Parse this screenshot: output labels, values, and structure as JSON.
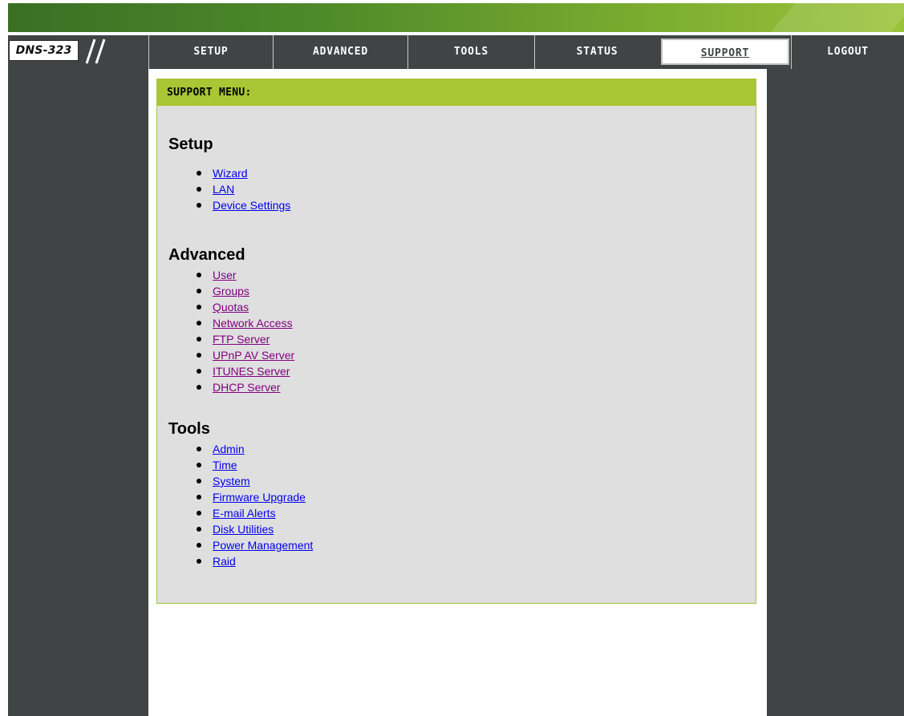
{
  "brand": {
    "logo_text": "DNS-323"
  },
  "nav": {
    "items": [
      {
        "label": "SETUP"
      },
      {
        "label": "ADVANCED"
      },
      {
        "label": "TOOLS"
      },
      {
        "label": "STATUS"
      },
      {
        "label": "SUPPORT",
        "active": true
      },
      {
        "label": "LOGOUT"
      }
    ]
  },
  "support": {
    "header": "SUPPORT MENU:",
    "sections": [
      {
        "title": "Setup",
        "links": [
          "Wizard",
          "LAN",
          "Device Settings"
        ]
      },
      {
        "title": "Advanced",
        "links": [
          "User",
          "Groups",
          "Quotas",
          "Network Access",
          "FTP Server",
          "UPnP AV Server",
          "ITUNES Server",
          "DHCP Server"
        ]
      },
      {
        "title": "Tools",
        "links": [
          "Admin",
          "Time",
          "System",
          "Firmware Upgrade",
          "E-mail Alerts",
          "Disk Utilities",
          "Power Management",
          "Raid"
        ]
      }
    ]
  },
  "colors": {
    "nav_background": "#404444",
    "panel_header": "#a9c634",
    "panel_background": "#dfdfdf",
    "link": "#0000ee",
    "visited_link": "#800080"
  }
}
